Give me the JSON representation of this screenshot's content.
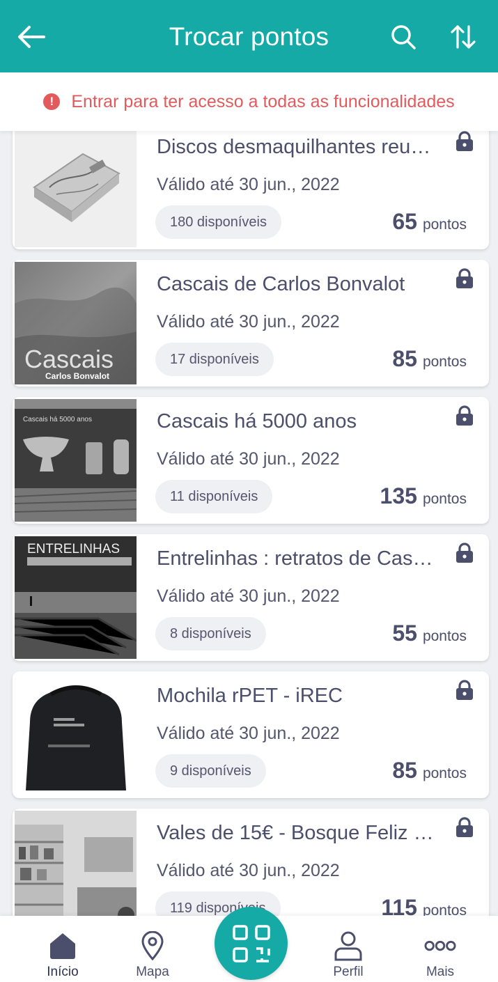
{
  "header": {
    "title": "Trocar pontos"
  },
  "banner": {
    "message": "Entrar para ter acesso a todas as funcionalidades"
  },
  "items": [
    {
      "name": "Discos desmaquilhantes reu…",
      "valid": "Válido até 30 jun., 2022",
      "available": "180 disponíveis",
      "points": "65",
      "points_unit": "pontos",
      "image_text": ""
    },
    {
      "name": "Cascais de Carlos Bonvalot",
      "valid": "Válido até 30 jun., 2022",
      "available": "17 disponíveis",
      "points": "85",
      "points_unit": "pontos",
      "image_text": "Cascais",
      "image_subtext": "Carlos Bonvalot"
    },
    {
      "name": "Cascais há 5000 anos",
      "valid": "Válido até 30 jun., 2022",
      "available": "11 disponíveis",
      "points": "135",
      "points_unit": "pontos",
      "image_text": "Cascais há 5000 anos"
    },
    {
      "name": "Entrelinhas : retratos de Cas…",
      "valid": "Válido até 30 jun., 2022",
      "available": "8 disponíveis",
      "points": "55",
      "points_unit": "pontos",
      "image_text": "ENTRELINHAS"
    },
    {
      "name": "Mochila rPET - iREC",
      "valid": "Válido até 30 jun., 2022",
      "available": "9 disponíveis",
      "points": "85",
      "points_unit": "pontos",
      "image_text": ""
    },
    {
      "name": "Vales de 15€ - Bosque Feliz …",
      "valid": "Válido até 30 jun., 2022",
      "available": "119 disponíveis",
      "points": "115",
      "points_unit": "pontos",
      "image_text": ""
    }
  ],
  "nav": {
    "home": "Início",
    "map": "Mapa",
    "profile": "Perfil",
    "more": "Mais"
  },
  "colors": {
    "accent": "#15aaa6",
    "warning": "#e25a5c",
    "text": "#4b4f6b",
    "chip": "#eff0f4"
  }
}
